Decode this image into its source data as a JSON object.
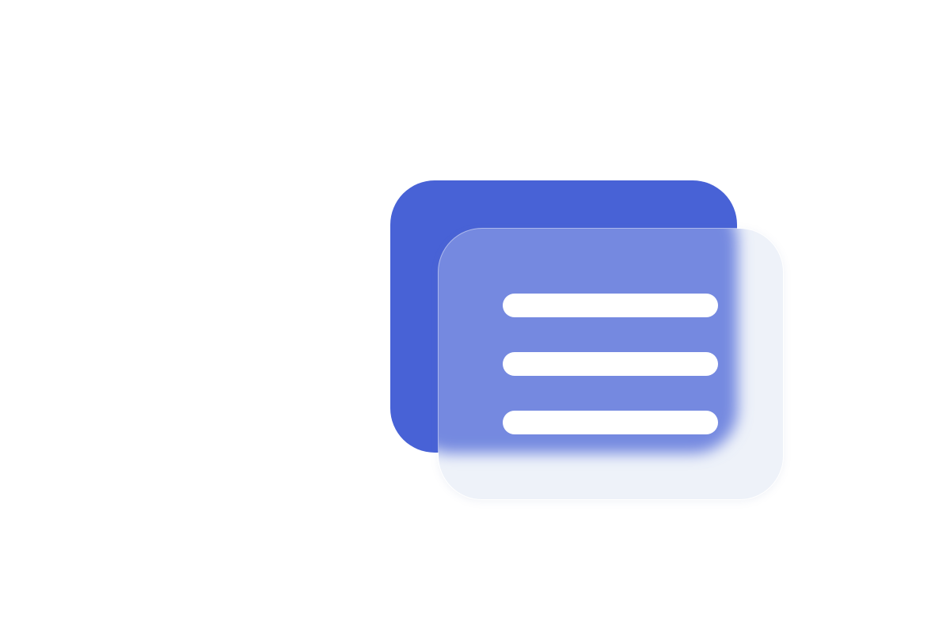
{
  "icon": {
    "name": "document-cards-icon",
    "colors": {
      "back_card": "#4862d6",
      "front_glass_tint": "#7589e0",
      "front_glass_frost": "#eef2f9",
      "lines": "#ffffff"
    },
    "line_count": 3
  }
}
